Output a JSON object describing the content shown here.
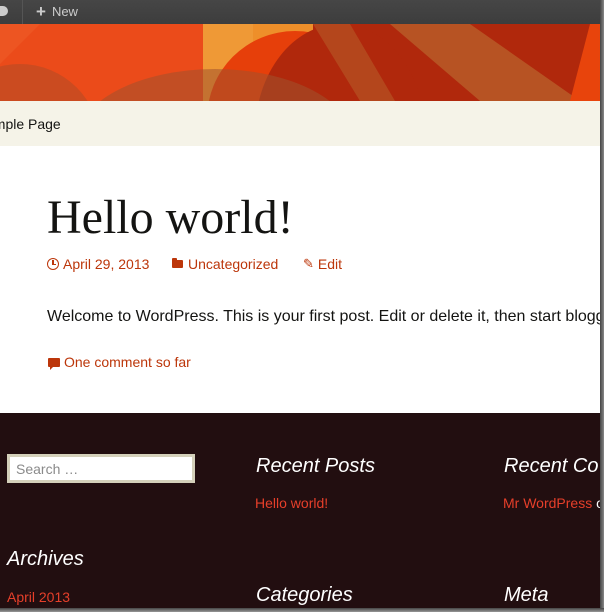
{
  "adminbar": {
    "comments_icon": "comment-bubble-icon",
    "new_icon": "plus-icon",
    "new_label": "New"
  },
  "navigation": {
    "items": [
      {
        "label": "ample Page"
      }
    ]
  },
  "post": {
    "title": "Hello world!",
    "meta": {
      "date_icon": "clock-icon",
      "date": "April 29, 2013",
      "category_icon": "folder-icon",
      "category": "Uncategorized",
      "edit_icon": "pencil-icon",
      "edit_label": "Edit"
    },
    "body": "Welcome to WordPress. This is your first post. Edit or delete it, then start bloggin",
    "comments_icon": "comment-icon",
    "comments_link": "One comment so far"
  },
  "footer": {
    "search": {
      "placeholder": "Search …",
      "value": ""
    },
    "widgets": {
      "recent_posts": {
        "title": "Recent Posts",
        "items": [
          "Hello world!"
        ]
      },
      "recent_comments": {
        "title": "Recent Co",
        "author": "Mr WordPress",
        "suffix": "o"
      },
      "archives": {
        "title": "Archives",
        "items": [
          "April 2013"
        ]
      },
      "categories": {
        "title": "Categories"
      },
      "meta": {
        "title": "Meta"
      }
    }
  },
  "colors": {
    "accent": "#bc360a",
    "footer_link": "#e63f2a",
    "footer_bg": "#220e10",
    "nav_bg": "#f5f3e8",
    "adminbar_bg": "#464646",
    "header_orange": "#eb4b1a"
  }
}
